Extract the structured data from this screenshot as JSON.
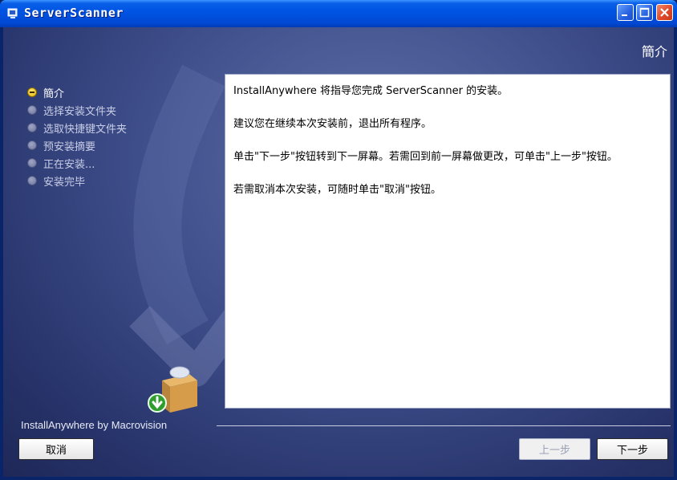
{
  "window": {
    "title": "ServerScanner",
    "controls": [
      "minimize",
      "maximize",
      "close"
    ]
  },
  "heading": "簡介",
  "steps": [
    {
      "label": "簡介",
      "active": true
    },
    {
      "label": "选择安装文件夹",
      "active": false
    },
    {
      "label": "选取快捷键文件夹",
      "active": false
    },
    {
      "label": "预安装摘要",
      "active": false
    },
    {
      "label": "正在安装...",
      "active": false
    },
    {
      "label": "安装完毕",
      "active": false
    }
  ],
  "content": {
    "paragraphs": [
      "InstallAnywhere 将指导您完成 ServerScanner 的安装。",
      "建议您在继续本次安装前，退出所有程序。",
      "单击\"下一步\"按钮转到下一屏幕。若需回到前一屏幕做更改，可单击\"上一步\"按钮。",
      "若需取消本次安装，可随时单击\"取消\"按钮。"
    ]
  },
  "footer": {
    "brand": "InstallAnywhere by Macrovision"
  },
  "buttons": {
    "cancel": "取消",
    "previous": "上一步",
    "next": "下一步"
  },
  "colors": {
    "titlebar": "#0054e3",
    "panel": "#3e4e8a",
    "active_bullet": "#e2b300"
  }
}
